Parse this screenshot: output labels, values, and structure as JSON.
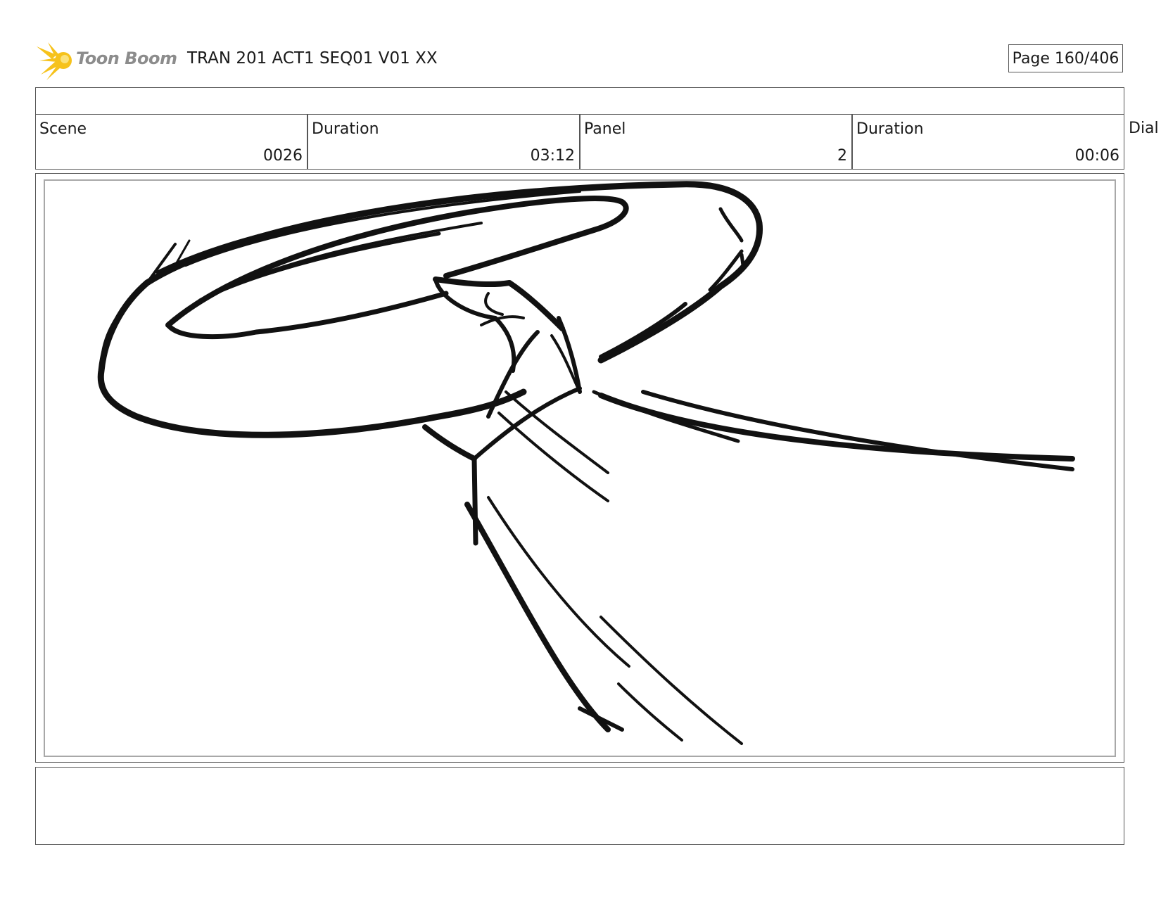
{
  "header": {
    "logo_text": "Toon Boom",
    "title": "TRAN 201 ACT1 SEQ01 V01 XX",
    "page": "Page 160/406"
  },
  "info": [
    {
      "label": "Scene",
      "value": "0026"
    },
    {
      "label": "Duration",
      "value": "03:12"
    },
    {
      "label": "Panel",
      "value": "2"
    },
    {
      "label": "Duration",
      "value": "00:06"
    }
  ],
  "dialog_label": "Dial",
  "colors": {
    "logo_yellow": "#f6c21b",
    "logo_gray": "#8c8c8c",
    "sketch_ink": "#111111",
    "frame_border": "#555555"
  }
}
